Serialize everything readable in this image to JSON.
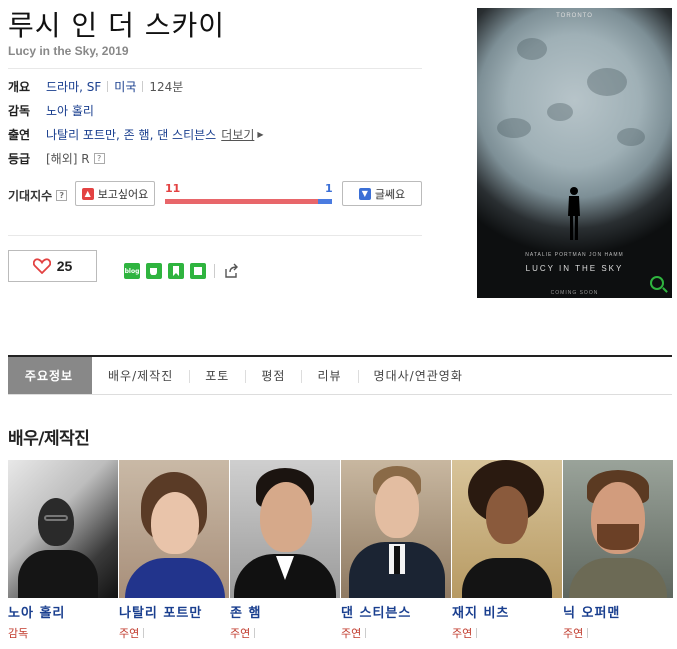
{
  "movie": {
    "title": "루시 인 더 스카이",
    "subtitle": "Lucy in the Sky, 2019"
  },
  "info": {
    "overview_label": "개요",
    "genres": [
      "드라마",
      "SF"
    ],
    "country": "미국",
    "runtime": "124분",
    "director_label": "감독",
    "director": "노아 홀리",
    "cast_label": "출연",
    "cast": "나탈리 포트만, 존 햄, 댄 스티븐스",
    "more": "더보기",
    "rating_label": "등급",
    "rating": "[해외] R"
  },
  "expectation": {
    "label": "기대지수",
    "want_button": "보고싶어요",
    "unsure_button": "글쎄요",
    "want_count": "11",
    "unsure_count": "1",
    "want_fraction": 0.917
  },
  "like": {
    "count": "25"
  },
  "share": {
    "icons": [
      "blog-icon",
      "cafe-icon",
      "bookmark-icon",
      "memo-icon",
      "share-icon"
    ],
    "blog_text": "blog"
  },
  "poster": {
    "festival": "TORONTO",
    "credits": "NATALIE PORTMAN    JON HAMM",
    "title": "LUCY IN THE SKY",
    "release": "COMING SOON"
  },
  "tabs": [
    "주요정보",
    "배우/제작진",
    "포토",
    "평점",
    "리뷰",
    "명대사/연관영화"
  ],
  "section_title": "배우/제작진",
  "crew": [
    {
      "name": "노아 홀리",
      "role": "감독"
    },
    {
      "name": "나탈리 포트만",
      "role": "주연"
    },
    {
      "name": "존 햄",
      "role": "주연"
    },
    {
      "name": "댄 스티븐스",
      "role": "주연"
    },
    {
      "name": "재지 비츠",
      "role": "주연"
    },
    {
      "name": "닉 오퍼맨",
      "role": "주연"
    }
  ],
  "colors": {
    "link": "#1a3f8f",
    "want": "#e8666a",
    "unsure": "#4a7be0",
    "naver_green": "#2fb43f"
  }
}
